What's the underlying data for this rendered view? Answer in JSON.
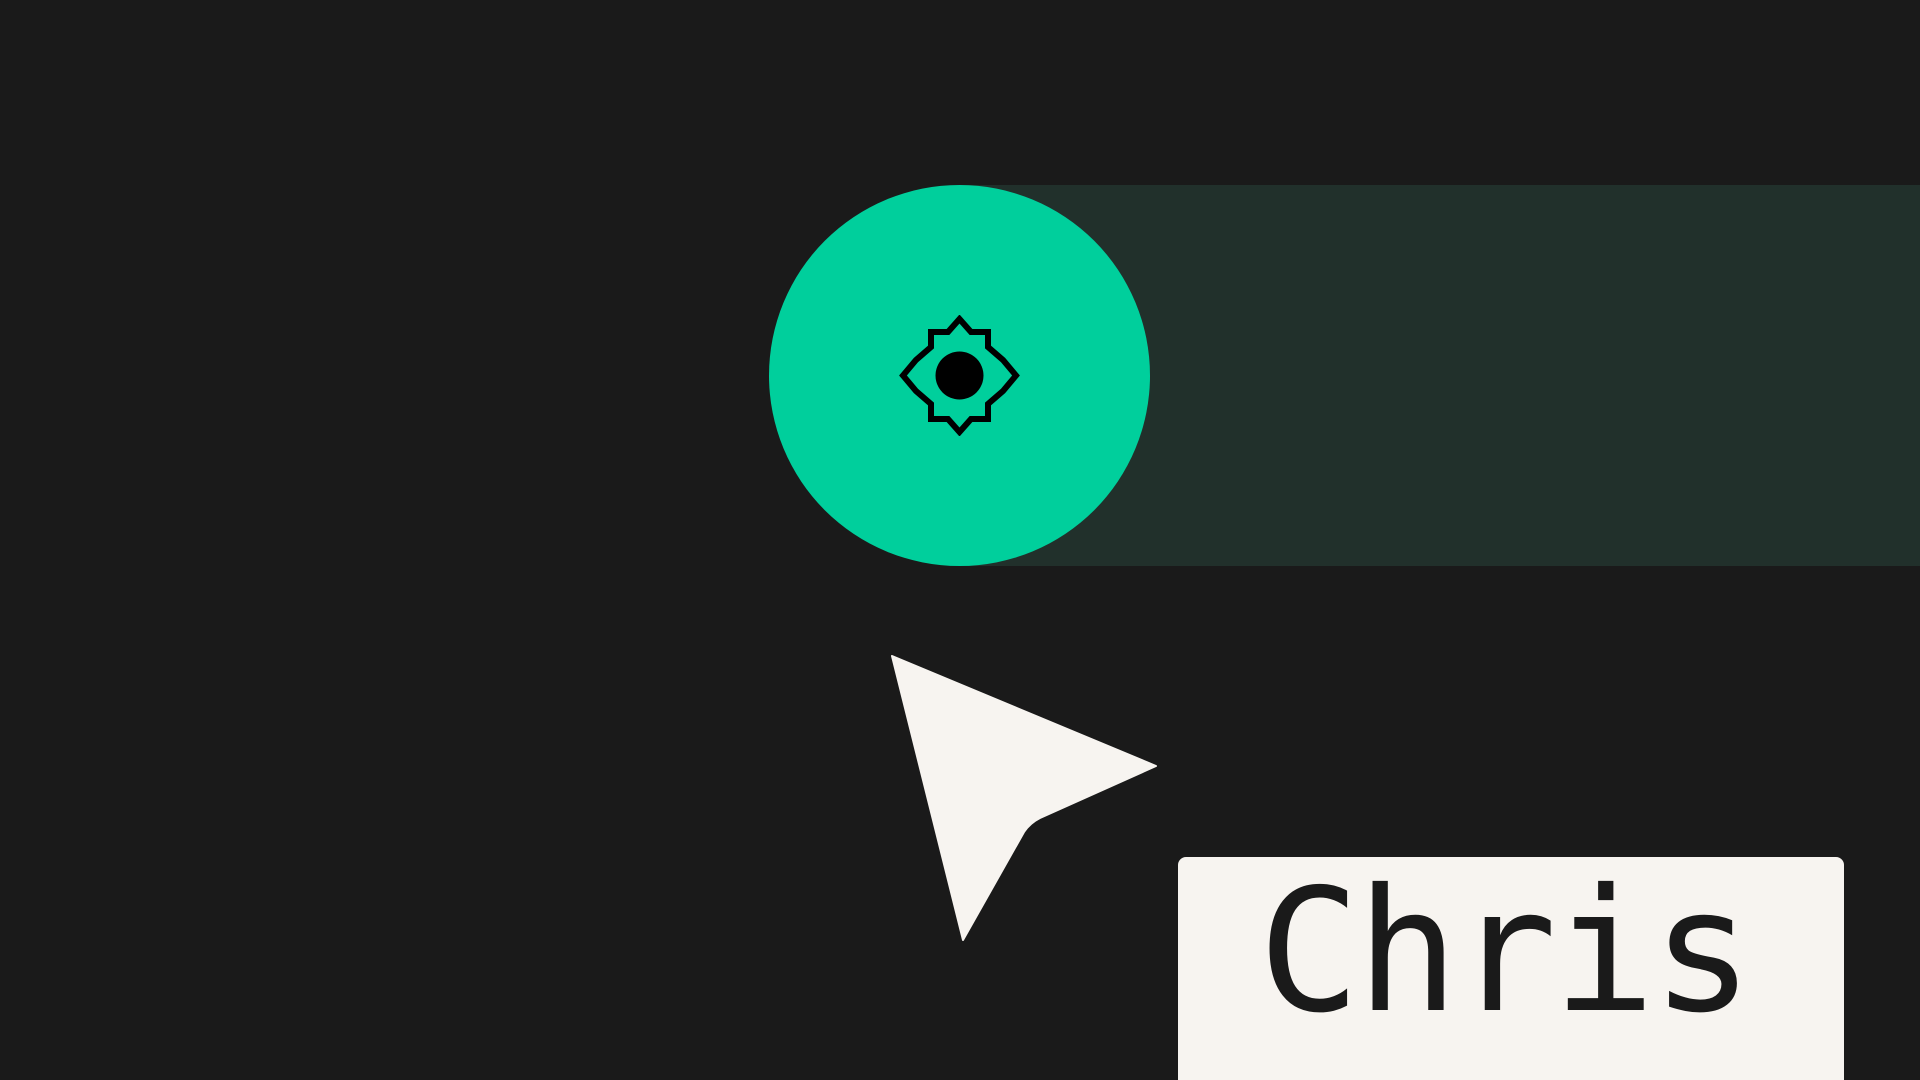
{
  "colors": {
    "background": "#1a1a1a",
    "accent": "#00cf9c",
    "track": "#21302b",
    "cursor": "#f7f4f0",
    "tag_background": "#f7f4f0",
    "tag_text": "#1a1a1a"
  },
  "toggle": {
    "state": "on",
    "icon": "brightness-icon"
  },
  "cursor": {
    "icon": "pointer-arrow-icon"
  },
  "name_tag": {
    "label": "Chris"
  }
}
